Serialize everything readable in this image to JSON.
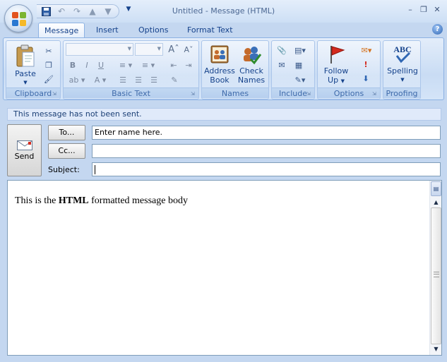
{
  "window": {
    "title": "Untitled - Message (HTML)",
    "controls": [
      "minimize",
      "restore",
      "close"
    ]
  },
  "qat": {
    "icons": [
      "save-icon",
      "undo-icon",
      "redo-icon",
      "previous-item-icon",
      "next-item-icon",
      "customize-qat-icon"
    ]
  },
  "tabs": [
    {
      "label": "Message",
      "active": true
    },
    {
      "label": "Insert",
      "active": false
    },
    {
      "label": "Options",
      "active": false
    },
    {
      "label": "Format Text",
      "active": false
    }
  ],
  "ribbon": {
    "clipboard": {
      "label": "Clipboard",
      "paste": "Paste"
    },
    "basic_text": {
      "label": "Basic Text",
      "font_name": "",
      "font_size": ""
    },
    "names": {
      "label": "Names",
      "address_book": [
        "Address",
        "Book"
      ],
      "check_names": [
        "Check",
        "Names"
      ]
    },
    "include": {
      "label": "Include"
    },
    "options": {
      "label": "Options",
      "follow_up": [
        "Follow",
        "Up"
      ]
    },
    "proofing": {
      "label": "Proofing",
      "spelling": "Spelling",
      "abc": "ABC"
    }
  },
  "infobar": {
    "text": "This message has not been sent."
  },
  "header": {
    "send_label": "Send",
    "to_label": "To...",
    "to_value": "Enter name here.",
    "cc_label": "Cc...",
    "cc_value": "",
    "subject_label": "Subject:",
    "subject_value": ""
  },
  "body": {
    "text_before": "This is the ",
    "text_bold": "HTML",
    "text_after": " formatted message body"
  },
  "colors": {
    "ribbon_bg": "#c9dcf4",
    "accent_text": "#15428b",
    "frame": "#c4d7f0"
  }
}
